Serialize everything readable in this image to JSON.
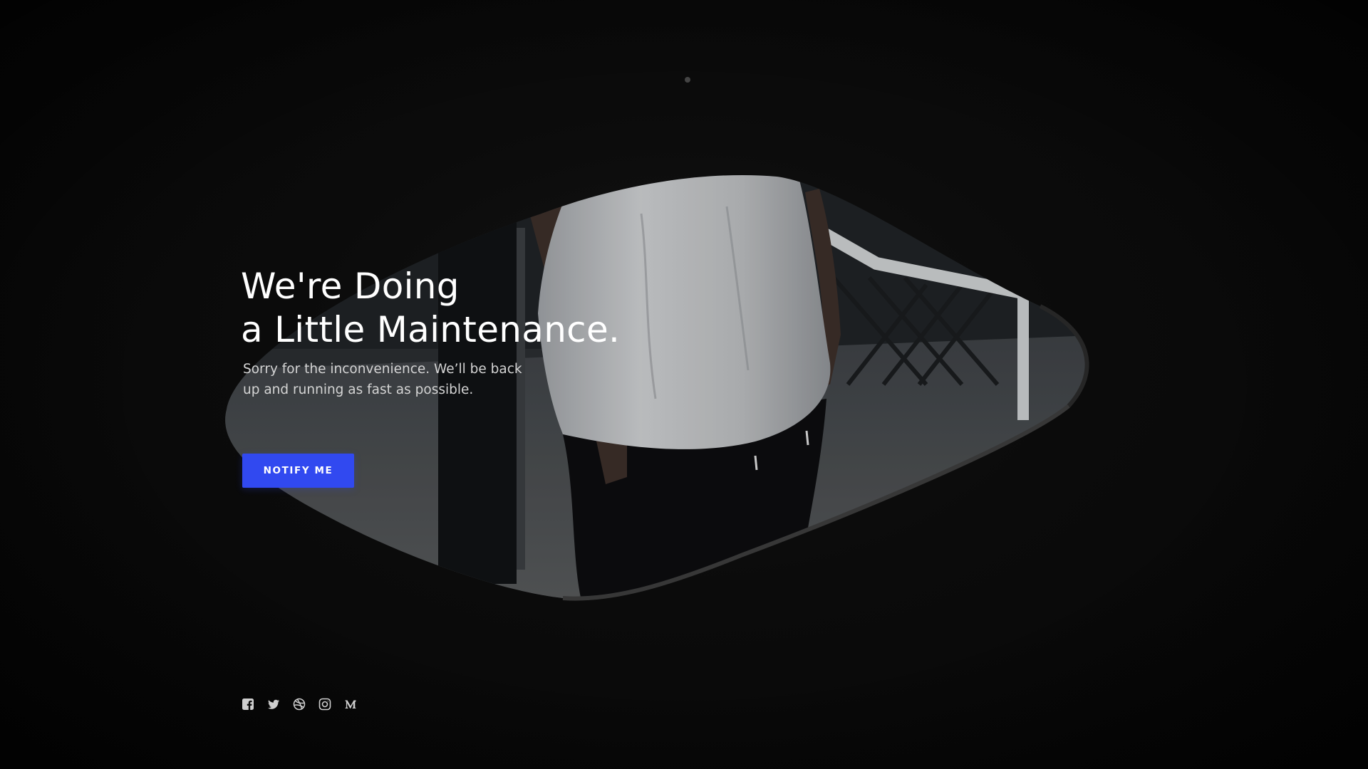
{
  "hero": {
    "headline_line1": "We're Doing",
    "headline_line2": "a Little Maintenance.",
    "subtext_line1": "Sorry for the inconvenience. We’ll be back",
    "subtext_line2": "up and running as fast as possible.",
    "button_label": "NOTIFY ME"
  },
  "social": {
    "items": [
      {
        "icon": "facebook-icon"
      },
      {
        "icon": "twitter-icon"
      },
      {
        "icon": "dribbble-icon"
      },
      {
        "icon": "instagram-icon"
      },
      {
        "icon": "medium-icon"
      }
    ]
  },
  "colors": {
    "background": "#0b0b0b",
    "accent": "#3149f0",
    "headline": "#ffffff",
    "subtext": "#d4d4d4",
    "icons": "#cfcfcf"
  }
}
